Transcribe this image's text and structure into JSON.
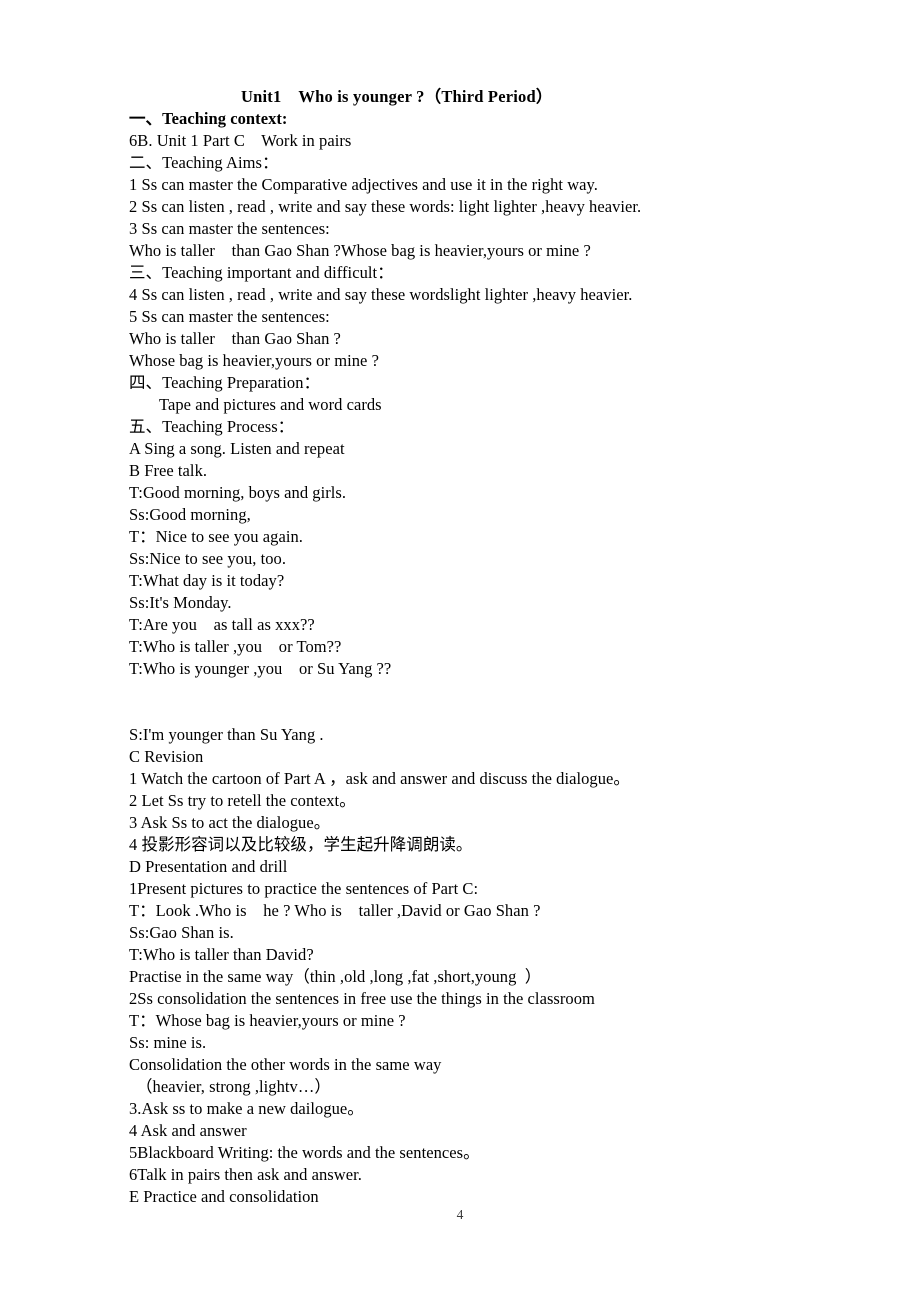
{
  "document": {
    "title": "Unit1    Who is younger ?（Third Period）",
    "page_number": "4",
    "body_lines": [
      {
        "text": "一、Teaching context:",
        "style": "bold"
      },
      {
        "text": "6B. Unit 1 Part C    Work in pairs",
        "style": "normal"
      },
      {
        "text": "二、Teaching Aims：",
        "style": "normal"
      },
      {
        "text": "1 Ss can master the Comparative adjectives and use it in the right way.",
        "style": "normal"
      },
      {
        "text": "2 Ss can listen , read , write and say these words: light lighter ,heavy heavier.",
        "style": "normal"
      },
      {
        "text": "3 Ss can master the sentences:",
        "style": "normal"
      },
      {
        "text": "Who is taller    than Gao Shan ?Whose bag is heavier,yours or mine ?",
        "style": "normal"
      },
      {
        "text": "三、Teaching important and difficult：",
        "style": "normal"
      },
      {
        "text": "4 Ss can listen , read , write and say these wordslight lighter ,heavy heavier.",
        "style": "normal"
      },
      {
        "text": "5 Ss can master the sentences:",
        "style": "normal"
      },
      {
        "text": "Who is taller    than Gao Shan ?",
        "style": "normal"
      },
      {
        "text": "Whose bag is heavier,yours or mine ?",
        "style": "normal"
      },
      {
        "text": "四、Teaching Preparation：",
        "style": "normal"
      },
      {
        "text": "Tape and pictures and word cards",
        "style": "indent-1"
      },
      {
        "text": "五、Teaching Process：",
        "style": "normal"
      },
      {
        "text": "A Sing a song. Listen and repeat",
        "style": "normal"
      },
      {
        "text": "B Free talk.",
        "style": "normal"
      },
      {
        "text": "T:Good morning, boys and girls.",
        "style": "normal"
      },
      {
        "text": "Ss:Good morning,",
        "style": "normal"
      },
      {
        "text": "T：Nice to see you again.",
        "style": "normal"
      },
      {
        "text": "Ss:Nice to see you, too.",
        "style": "normal"
      },
      {
        "text": "T:What day is it today?",
        "style": "normal"
      },
      {
        "text": "Ss:It's Monday.",
        "style": "normal"
      },
      {
        "text": "T:Are you    as tall as xxx??",
        "style": "normal"
      },
      {
        "text": "T:Who is taller ,you    or Tom??",
        "style": "normal"
      },
      {
        "text": "T:Who is younger ,you    or Su Yang ??",
        "style": "normal"
      },
      {
        "text": "",
        "style": "spacer-tall"
      },
      {
        "text": "S:I'm younger than Su Yang .",
        "style": "normal"
      },
      {
        "text": "C Revision",
        "style": "normal"
      },
      {
        "text": "1 Watch the cartoon of Part A ，ask and answer and discuss the dialogue。",
        "style": "normal"
      },
      {
        "text": "2 Let Ss try to retell the context。",
        "style": "normal"
      },
      {
        "text": "3 Ask Ss to act the dialogue。",
        "style": "normal"
      },
      {
        "text": "4 投影形容词以及比较级，学生起升降调朗读。",
        "style": "normal"
      },
      {
        "text": "D Presentation and drill",
        "style": "normal"
      },
      {
        "text": "1Present pictures to practice the sentences of Part C:",
        "style": "normal"
      },
      {
        "text": "T：Look .Who is    he ? Who is    taller ,David or Gao Shan ?",
        "style": "normal"
      },
      {
        "text": "Ss:Gao Shan is.",
        "style": "normal"
      },
      {
        "text": "T:Who is taller than David?",
        "style": "normal"
      },
      {
        "text": "Practise in the same way（thin ,old ,long ,fat ,short,young  ）",
        "style": "normal"
      },
      {
        "text": "2Ss consolidation the sentences in free use the things in the classroom",
        "style": "normal"
      },
      {
        "text": "T：Whose bag is heavier,yours or mine ?",
        "style": "normal"
      },
      {
        "text": "Ss: mine is.",
        "style": "normal"
      },
      {
        "text": "Consolidation the other words in the same way",
        "style": "normal"
      },
      {
        "text": "（heavier, strong ,lightv…）",
        "style": "indent-sm"
      },
      {
        "text": "3.Ask ss to make a new dailogue。",
        "style": "normal"
      },
      {
        "text": "4 Ask and answer",
        "style": "normal"
      },
      {
        "text": "5Blackboard Writing: the words and the sentences。",
        "style": "normal"
      },
      {
        "text": "6Talk in pairs then ask and answer.",
        "style": "normal"
      },
      {
        "text": "E Practice and consolidation",
        "style": "normal"
      }
    ]
  }
}
